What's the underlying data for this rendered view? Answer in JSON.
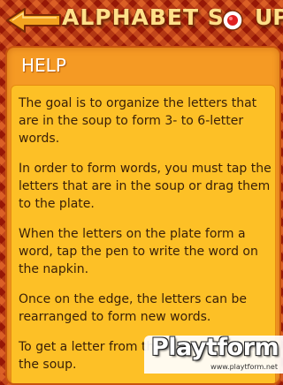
{
  "header": {
    "back_icon": "back-arrow-icon",
    "title": "ALPHABET S",
    "title_bowl_icon": "soup-bowl-icon",
    "title_suffix": "UP"
  },
  "help": {
    "heading": "HELP",
    "paragraphs": [
      "The goal is to organize the letters that are in the soup to form 3- to 6-letter words.",
      "In order to form words, you must tap the letters that are in the soup or drag them to the plate.",
      "When the letters on the plate form a word, tap the pen to write the word on the napkin.",
      "Once on the edge, the letters can be rearranged to form new words.",
      "To get a letter from the edge, drag it to the soup."
    ]
  },
  "watermark": {
    "logo": "Playtform",
    "url": "www.playtform.net"
  },
  "colors": {
    "background": "#b4260b",
    "panel": "#f59a24",
    "panel_body": "#fdc026",
    "title": "#ffe08a",
    "text": "#3a2008"
  }
}
